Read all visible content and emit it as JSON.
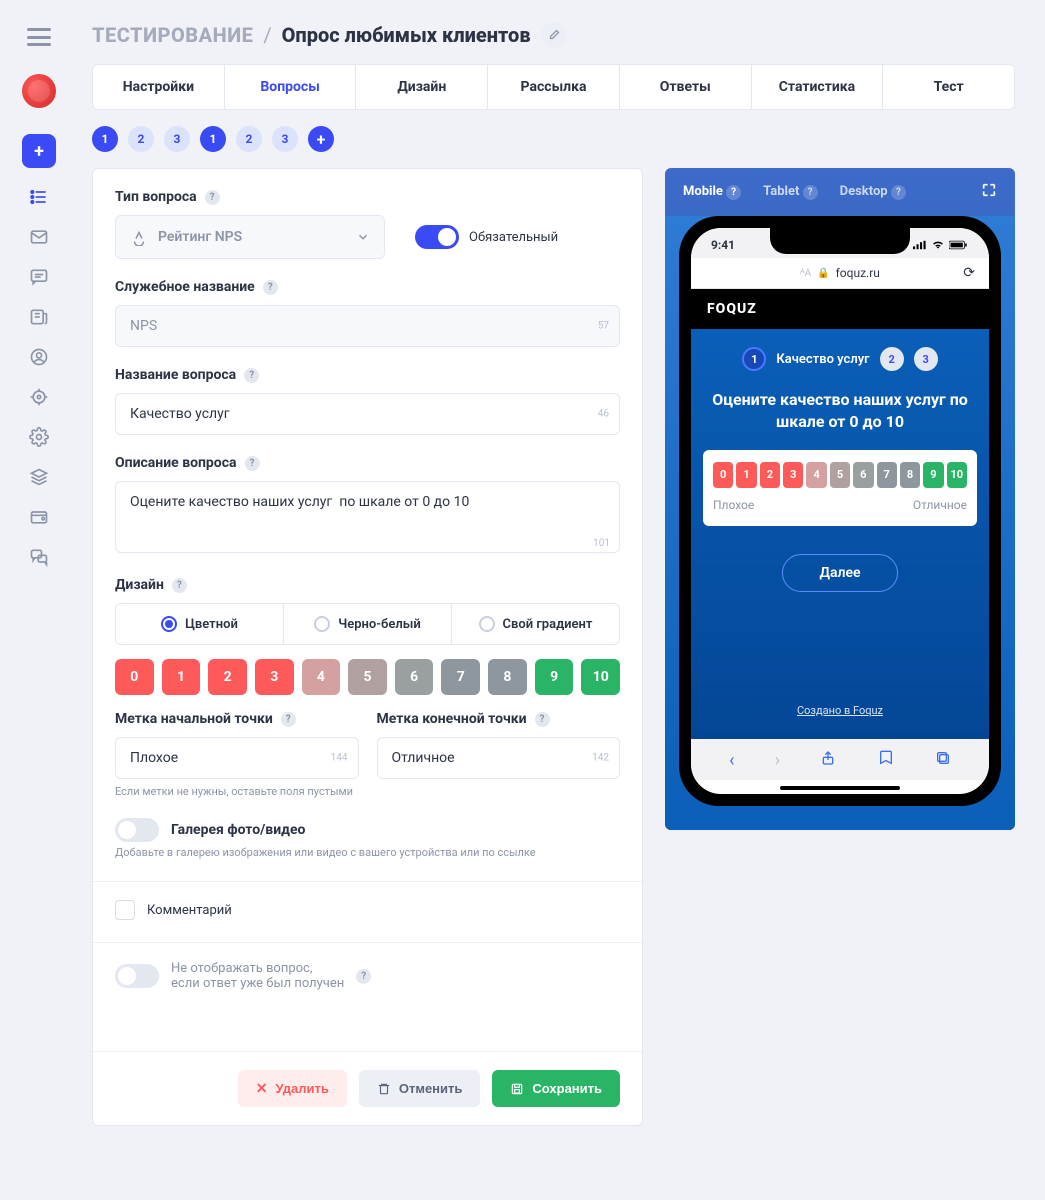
{
  "header": {
    "crumb1": "ТЕСТИРОВАНИЕ",
    "crumb2": "Опрос любимых клиентов"
  },
  "tabs": [
    "Настройки",
    "Вопросы",
    "Дизайн",
    "Рассылка",
    "Ответы",
    "Статистика",
    "Тест"
  ],
  "active_tab": 1,
  "qnav": {
    "items": [
      "1",
      "2",
      "3"
    ],
    "active": 0
  },
  "form": {
    "type_label": "Тип вопроса",
    "type_value": "Рейтинг NPS",
    "required_label": "Обязательный",
    "service_name_label": "Служебное название",
    "service_name_value": "NPS",
    "service_name_count": "57",
    "question_name_label": "Название вопроса",
    "question_name_value": "Качество услуг",
    "question_name_count": "46",
    "description_label": "Описание вопроса",
    "description_value": "Оцените качество наших услуг  по шкале от 0 до 10",
    "description_count": "101",
    "design_label": "Дизайн",
    "design_opts": [
      "Цветной",
      "Черно-белый",
      "Свой градиент"
    ],
    "scale": [
      {
        "n": "0",
        "c": "#ff5a5a"
      },
      {
        "n": "1",
        "c": "#ff5a5a"
      },
      {
        "n": "2",
        "c": "#ff5a5a"
      },
      {
        "n": "3",
        "c": "#ff5a5a"
      },
      {
        "n": "4",
        "c": "#d4a0a0"
      },
      {
        "n": "5",
        "c": "#b0a0a0"
      },
      {
        "n": "6",
        "c": "#9aa0a0"
      },
      {
        "n": "7",
        "c": "#8e969e"
      },
      {
        "n": "8",
        "c": "#8e969e"
      },
      {
        "n": "9",
        "c": "#2ab566"
      },
      {
        "n": "10",
        "c": "#2ab566"
      }
    ],
    "start_label_title": "Метка начальной точки",
    "start_label_value": "Плохое",
    "start_label_count": "144",
    "end_label_title": "Метка конечной точки",
    "end_label_value": "Отличное",
    "end_label_count": "142",
    "labels_hint": "Если метки не нужны, оставьте поля пустыми",
    "gallery_label": "Галерея фото/видео",
    "gallery_hint": "Добавьте в галерею изображения или видео с вашего устройства или по ссылке",
    "comment_label": "Комментарий",
    "hide_label_1": "Не отображать вопрос,",
    "hide_label_2": "если ответ уже был получен"
  },
  "actions": {
    "delete": "Удалить",
    "cancel": "Отменить",
    "save": "Сохранить"
  },
  "preview": {
    "tabs": [
      "Mobile",
      "Tablet",
      "Desktop"
    ],
    "status_time": "9:41",
    "url": "foquz.ru",
    "brand": "FOQUZ",
    "steps": [
      {
        "n": "1",
        "label": "Качество услуг",
        "active": true
      },
      {
        "n": "2",
        "active": false
      },
      {
        "n": "3",
        "active": false
      }
    ],
    "title": "Оцените качество наших услуг по шкале от 0 до 10",
    "scale": [
      {
        "n": "0",
        "c": "#ff5a5a"
      },
      {
        "n": "1",
        "c": "#ff5a5a"
      },
      {
        "n": "2",
        "c": "#ff5a5a"
      },
      {
        "n": "3",
        "c": "#ff5a5a"
      },
      {
        "n": "4",
        "c": "#d4a0a0"
      },
      {
        "n": "5",
        "c": "#b0a0a0"
      },
      {
        "n": "6",
        "c": "#9aa0a0"
      },
      {
        "n": "7",
        "c": "#8e969e"
      },
      {
        "n": "8",
        "c": "#8e969e"
      },
      {
        "n": "9",
        "c": "#2ab566"
      },
      {
        "n": "10",
        "c": "#2ab566"
      }
    ],
    "start_label": "Плохое",
    "end_label": "Отличное",
    "next": "Далее",
    "credit": "Создано в Foquz"
  }
}
